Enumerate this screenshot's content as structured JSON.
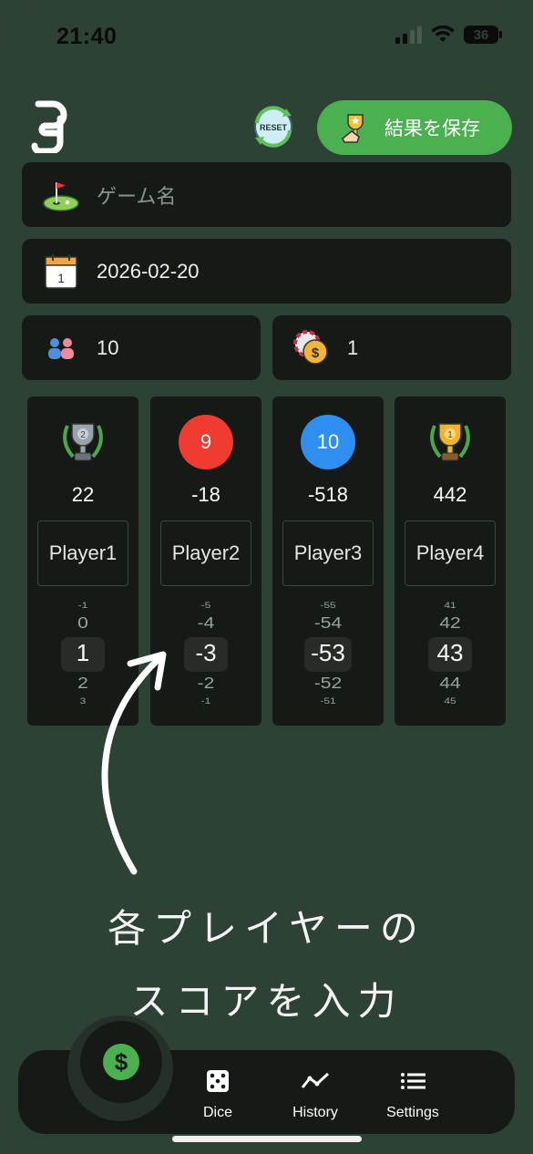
{
  "status_bar": {
    "time": "21:40",
    "battery": "36"
  },
  "header": {
    "reset_label": "RESET",
    "save_label": "結果を保存"
  },
  "game_name": {
    "placeholder": "ゲーム名",
    "value": ""
  },
  "date": {
    "value": "2026-02-20",
    "calendar_day": "1"
  },
  "players_count": {
    "value": "10"
  },
  "rate": {
    "value": "1"
  },
  "players": [
    {
      "rank_type": "silver-trophy",
      "rank_label": "2",
      "total": "22",
      "name": "Player1",
      "picker": [
        "-1",
        "0",
        "1",
        "2",
        "3"
      ]
    },
    {
      "rank_type": "badge",
      "rank_label": "9",
      "badge_color": "#f03b30",
      "total": "-18",
      "name": "Player2",
      "picker": [
        "-5",
        "-4",
        "-3",
        "-2",
        "-1"
      ]
    },
    {
      "rank_type": "badge",
      "rank_label": "10",
      "badge_color": "#2f8ff0",
      "total": "-518",
      "name": "Player3",
      "picker": [
        "-55",
        "-54",
        "-53",
        "-52",
        "-51"
      ]
    },
    {
      "rank_type": "gold-trophy",
      "rank_label": "1",
      "total": "442",
      "name": "Player4",
      "picker": [
        "41",
        "42",
        "43",
        "44",
        "45"
      ]
    }
  ],
  "annotation": {
    "line1": "各プレイヤーの",
    "line2": "スコアを入力"
  },
  "tabs": {
    "dice": "Dice",
    "history": "History",
    "settings": "Settings"
  },
  "colors": {
    "background": "#2e4135",
    "card": "#151a16",
    "accent": "#4caf50"
  }
}
